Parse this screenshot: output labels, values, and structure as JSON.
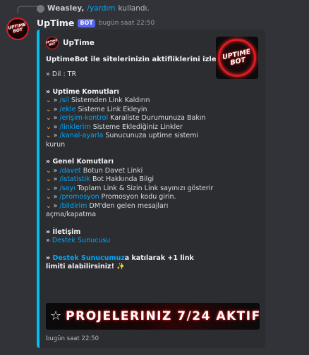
{
  "reply": {
    "username": "Weasley,",
    "command": "/yardım",
    "suffix": "kullandı."
  },
  "message": {
    "author": "UpTime",
    "badge": "BOT",
    "time": "bugün saat 22:50",
    "avatar_text_1": "UPTIME",
    "avatar_text_2": "BOT"
  },
  "embed": {
    "accent_color": "#00c2f2",
    "author_name": "UpTime",
    "thumbnail_text_1": "UPTIME",
    "thumbnail_text_2": "BOT",
    "title": "UptimeBot ile sitelerinizin aktifliklerini izleyin",
    "language_line": "» Dil : TR",
    "uptime_header": "» Uptime Komutları",
    "uptime_commands": [
      {
        "cmd": "/sil",
        "desc": "Sistemden Link Kaldırın"
      },
      {
        "cmd": "/ekle",
        "desc": "Sisteme Link Ekleyin"
      },
      {
        "cmd": "/erişim-kontrol",
        "desc": "Karaliste Durumunuza Bakın"
      },
      {
        "cmd": "/linklerim",
        "desc": "Sisteme Eklediğiniz Linkler"
      },
      {
        "cmd": "/kanal-ayarla",
        "desc": "Sunucunuza uptime sistemi kurun"
      }
    ],
    "general_header": "» Genel Komutları",
    "general_commands": [
      {
        "cmd": "/davet",
        "desc": "Botun Davet Linki"
      },
      {
        "cmd": "/istatistik",
        "desc": "Bot Hakkında Bilgi"
      },
      {
        "cmd": "/sayı",
        "desc": "Toplam Link & Sizin Link sayınızı gösterir"
      },
      {
        "cmd": "/promosyon",
        "desc": "Promosyon kodu girin."
      },
      {
        "cmd": "/bildirim",
        "desc": "DM'den gelen mesajları açma/kapatma"
      }
    ],
    "contact_header": "» İletişim",
    "contact_prefix": "»",
    "contact_link": "Destek Sunucusu",
    "promo_prefix": "»",
    "promo_link": "Destek Sunucumuz",
    "promo_rest": "a katılarak +1 link limiti alabilirsiniz!",
    "promo_emoji": "✨",
    "banner_text": "PROJELERINIZ 7/24 AKTIF",
    "banner_icon": "star-outline-icon",
    "footer_time": "bugün saat 22:50"
  }
}
